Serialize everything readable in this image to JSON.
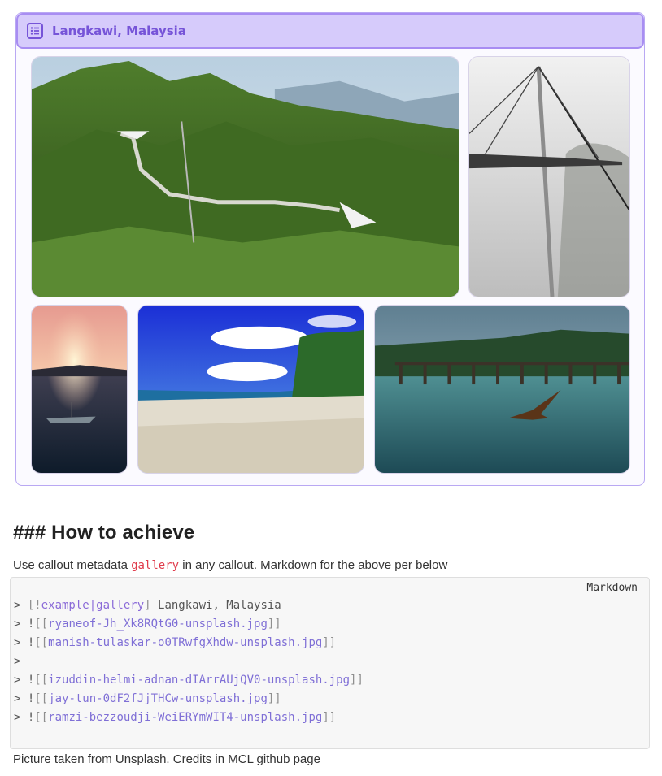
{
  "callout": {
    "icon": "list-icon",
    "title": "Langkawi, Malaysia",
    "images": [
      {
        "name": "ryaneof-Jh_Xk8RQtG0-unsplash.jpg",
        "subject": "sky bridge over green mountains"
      },
      {
        "name": "manish-tulaskar-o0TRwfgXhdw-unsplash.jpg",
        "subject": "sky bridge pylon in mist"
      },
      {
        "name": "izuddin-helmi-adnan-dIArrAUjQV0-unsplash.jpg",
        "subject": "sunset with boat"
      },
      {
        "name": "jay-tun-0dF2fJjTHCw-unsplash.jpg",
        "subject": "beach with blue sky"
      },
      {
        "name": "ramzi-bezzoudji-WeiERYmWIT4-unsplash.jpg",
        "subject": "eagle over water with pier"
      }
    ]
  },
  "section": {
    "heading": "### How to achieve",
    "para_before": "Use callout metadata ",
    "para_code": "gallery",
    "para_after": " in any callout. Markdown for the above per below"
  },
  "code": {
    "language": "Markdown",
    "lines": {
      "l1_prefix": "> ",
      "l1_open": "[!",
      "l1_type": "example|gallery",
      "l1_close": "]",
      "l1_text": " Langkawi, Malaysia",
      "l2": "ryaneof-Jh_Xk8RQtG0-unsplash.jpg",
      "l3": "manish-tulaskar-o0TRwfgXhdw-unsplash.jpg",
      "l4": ">",
      "l5": "izuddin-helmi-adnan-dIArrAUjQV0-unsplash.jpg",
      "l6": "jay-tun-0dF2fJjTHCw-unsplash.jpg",
      "l7": "ramzi-bezzoudji-WeiERYmWIT4-unsplash.jpg"
    },
    "embed_prefix": "> !",
    "embed_open": "[[",
    "embed_close": "]]"
  },
  "caption": "Picture taken from Unsplash. Credits in MCL github page",
  "colors": {
    "callout_header_bg": "#d6cbfb",
    "callout_title": "#7654d8",
    "inline_code": "#e03c4c",
    "link": "#7f6fd6"
  }
}
